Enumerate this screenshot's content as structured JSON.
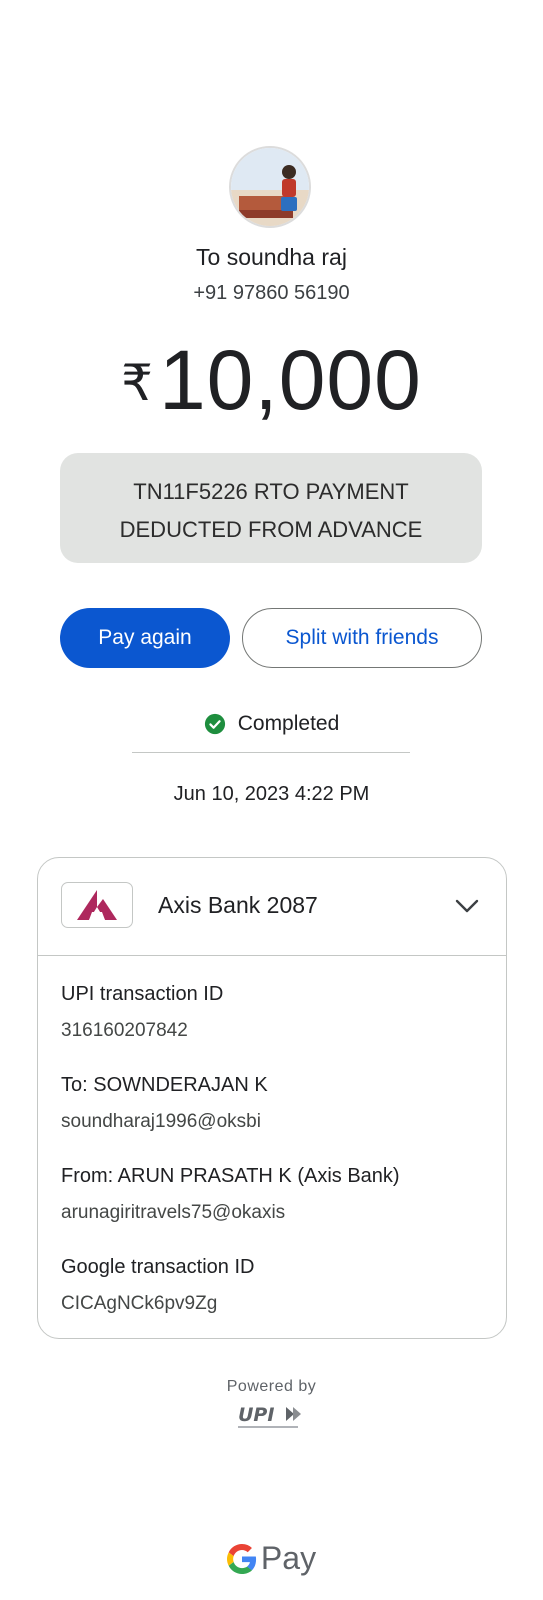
{
  "recipient": {
    "name": "To soundha raj",
    "phone": "+91 97860 56190"
  },
  "payment": {
    "currency_symbol": "₹",
    "amount": "10,000",
    "note": "TN11F5226 RTO PAYMENT DEDUCTED FROM ADVANCE"
  },
  "actions": {
    "pay_again": "Pay again",
    "split": "Split with friends"
  },
  "status": {
    "label": "Completed",
    "datetime": "Jun 10, 2023 4:22 PM"
  },
  "bank": {
    "name": "Axis Bank 2087"
  },
  "details": [
    {
      "label": "UPI transaction ID",
      "value": "316160207842"
    },
    {
      "label": "To: SOWNDERAJAN  K",
      "value": "soundharaj1996@oksbi"
    },
    {
      "label": "From: ARUN PRASATH K (Axis Bank)",
      "value": "arunagiritravels75@okaxis"
    },
    {
      "label": "Google transaction ID",
      "value": "CICAgNCk6pv9Zg"
    }
  ],
  "footer": {
    "powered_by": "Powered by",
    "upi_logo_text": "UPI",
    "gpay_label": "Pay"
  },
  "colors": {
    "primary": "#0b57d0",
    "success": "#1e8e3e",
    "axis_brand": "#ae285d"
  },
  "icons": {
    "status": "check-circle-icon",
    "expand": "chevron-down-icon",
    "bank": "axis-bank-logo",
    "brand": "google-g-icon"
  }
}
